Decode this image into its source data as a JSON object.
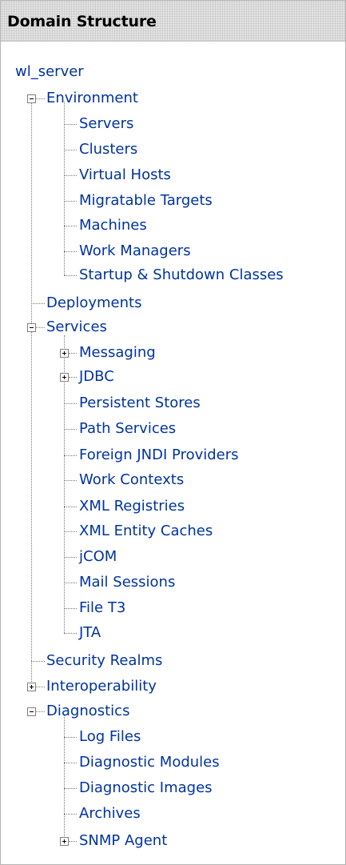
{
  "header": {
    "title": "Domain Structure"
  },
  "tree": {
    "root": "wl_server",
    "environment": {
      "label": "Environment",
      "children": [
        "Servers",
        "Clusters",
        "Virtual Hosts",
        "Migratable Targets",
        "Machines",
        "Work Managers",
        "Startup & Shutdown Classes"
      ]
    },
    "deployments": "Deployments",
    "services": {
      "label": "Services",
      "children": [
        "Messaging",
        "JDBC",
        "Persistent Stores",
        "Path Services",
        "Foreign JNDI Providers",
        "Work Contexts",
        "XML Registries",
        "XML Entity Caches",
        "jCOM",
        "Mail Sessions",
        "File T3",
        "JTA"
      ]
    },
    "security_realms": "Security Realms",
    "interoperability": "Interoperability",
    "diagnostics": {
      "label": "Diagnostics",
      "children": [
        "Log Files",
        "Diagnostic Modules",
        "Diagnostic Images",
        "Archives",
        "SNMP Agent"
      ]
    }
  }
}
